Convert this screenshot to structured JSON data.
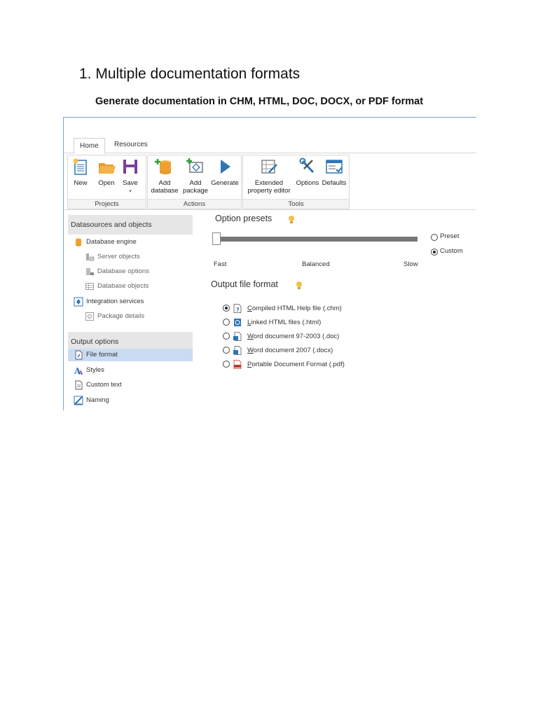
{
  "heading": "1. Multiple documentation formats",
  "subheading": "Generate documentation in CHM, HTML, DOC, DOCX, or PDF format",
  "app": {
    "tabs": [
      {
        "label": "Home",
        "active": true
      },
      {
        "label": "Resources",
        "active": false
      }
    ],
    "ribbon": {
      "groups": [
        {
          "label": "Projects",
          "buttons": [
            {
              "label": "New",
              "icon": "new-document-icon"
            },
            {
              "label": "Open",
              "icon": "open-folder-icon"
            },
            {
              "label": "Save",
              "sublabel": "▾",
              "icon": "save-disk-icon"
            }
          ]
        },
        {
          "label": "Actions",
          "buttons": [
            {
              "label": "Add",
              "label2": "database",
              "icon": "add-database-icon"
            },
            {
              "label": "Add",
              "label2": "package",
              "icon": "add-package-icon"
            },
            {
              "label": "Generate",
              "icon": "play-triangle-icon"
            }
          ]
        },
        {
          "label": "Tools",
          "buttons": [
            {
              "label": "Extended",
              "label2": "property editor",
              "icon": "property-editor-icon"
            },
            {
              "label": "Options",
              "icon": "wrench-screwdriver-icon"
            },
            {
              "label": "Defaults",
              "icon": "defaults-window-icon"
            }
          ]
        }
      ]
    },
    "sidebar": {
      "datasources_header": "Datasources and objects",
      "datasources_items": [
        {
          "label": "Database engine",
          "icon": "database-cylinder-icon",
          "level": 0
        },
        {
          "label": "Server objects",
          "icon": "server-objects-icon",
          "level": 1
        },
        {
          "label": "Database options",
          "icon": "database-options-icon",
          "level": 1
        },
        {
          "label": "Database objects",
          "icon": "database-objects-icon",
          "level": 1
        },
        {
          "label": "Integration services",
          "icon": "integration-services-icon",
          "level": 0
        },
        {
          "label": "Package details",
          "icon": "package-details-icon",
          "level": 1
        }
      ],
      "output_header": "Output options",
      "output_items": [
        {
          "label": "File format",
          "icon": "file-format-icon",
          "selected": true
        },
        {
          "label": "Styles",
          "icon": "styles-icon",
          "selected": false
        },
        {
          "label": "Custom text",
          "icon": "custom-text-icon",
          "selected": false
        },
        {
          "label": "Naming",
          "icon": "naming-icon",
          "selected": false
        }
      ]
    },
    "presets": {
      "title": "Option presets",
      "slider_min_label": "Fast",
      "slider_mid_label": "Balanced",
      "slider_max_label": "Slow",
      "slider_level": 0,
      "preset_label": "Preset",
      "custom_label": "Custom",
      "selected": "Custom"
    },
    "output_format": {
      "title": "Output file format",
      "options": [
        {
          "label": "Compiled HTML Help file (.chm)",
          "icon": "chm-help-icon",
          "checked": true
        },
        {
          "label": "Linked HTML files (.html)",
          "icon": "html-files-icon",
          "checked": false
        },
        {
          "label": "Word document 97-2003 (.doc)",
          "icon": "word-doc-icon",
          "checked": false
        },
        {
          "label": "Word document 2007 (.docx)",
          "icon": "word-docx-icon",
          "checked": false
        },
        {
          "label": "Portable Document Format (.pdf)",
          "icon": "pdf-icon",
          "checked": false
        }
      ]
    }
  },
  "colors": {
    "frame_border": "#7da2ce",
    "selection": "#c9dcf3",
    "section_header_bg": "#e6e6e6",
    "icon_blue": "#2e75b6",
    "icon_orange": "#f0a030",
    "icon_purple": "#7b3f9e",
    "bulb": "#f3c04a"
  }
}
